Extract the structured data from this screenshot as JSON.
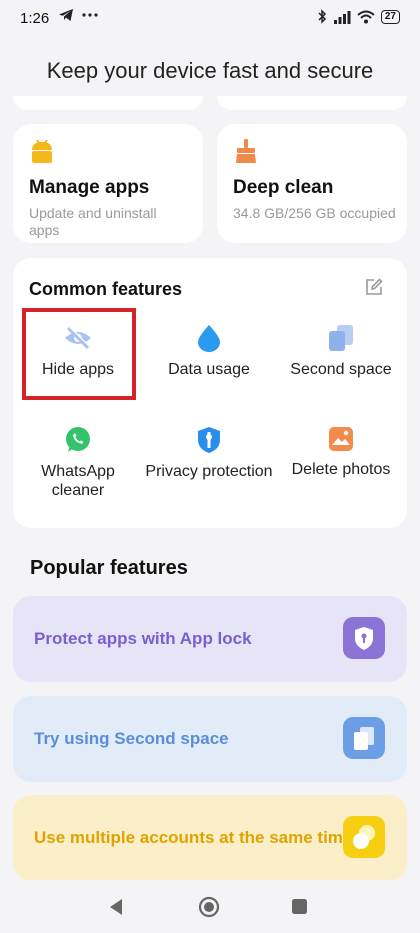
{
  "status_bar": {
    "time": "1:26",
    "battery": "27"
  },
  "header": {
    "title": "Keep your device fast and secure"
  },
  "cards": {
    "manage_apps": {
      "title": "Manage apps",
      "subtitle": "Update and uninstall apps"
    },
    "deep_clean": {
      "title": "Deep clean",
      "subtitle": "34.8 GB/256 GB occupied"
    }
  },
  "common_features": {
    "title": "Common features",
    "items": [
      {
        "label": "Hide apps",
        "icon": "eye-slash-icon"
      },
      {
        "label": "Data usage",
        "icon": "water-drop-icon"
      },
      {
        "label": "Second space",
        "icon": "second-space-icon"
      },
      {
        "label": "WhatsApp cleaner",
        "icon": "whatsapp-icon"
      },
      {
        "label": "Privacy protection",
        "icon": "shield-icon"
      },
      {
        "label": "Delete photos",
        "icon": "photo-icon"
      }
    ]
  },
  "popular_features": {
    "title": "Popular features",
    "items": [
      {
        "label": "Protect apps with App lock",
        "color": "#7a5fd0",
        "bg": "#e8e4f7"
      },
      {
        "label": "Try using Second space",
        "color": "#5b8ed8",
        "bg": "#e2ecf8"
      },
      {
        "label": "Use multiple accounts at the same time",
        "color": "#e0a400",
        "bg": "#fbefc9"
      }
    ]
  },
  "colors": {
    "highlight_border": "#d7222c",
    "background": "#f4f4f6"
  }
}
